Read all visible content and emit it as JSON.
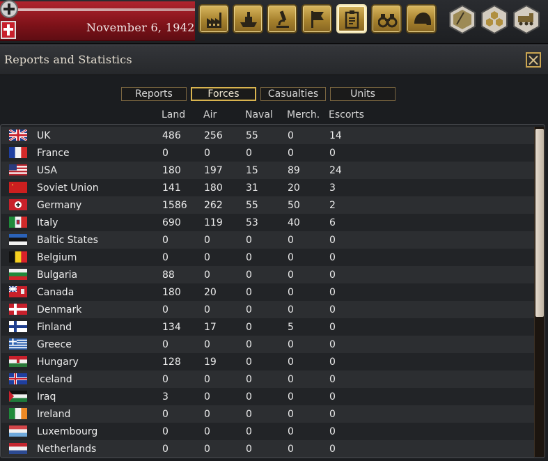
{
  "header": {
    "date": "November 6, 1942"
  },
  "toolbar": {
    "buttons": [
      {
        "icon": "factory-icon"
      },
      {
        "icon": "ship-icon"
      },
      {
        "icon": "microscope-icon"
      },
      {
        "icon": "flag-icon"
      },
      {
        "icon": "clipboard-icon",
        "active": true
      },
      {
        "icon": "binoculars-icon"
      },
      {
        "icon": "helmet-icon"
      }
    ],
    "map_modes": [
      {
        "icon": "terrain-hex-icon"
      },
      {
        "icon": "resource-hex-icon"
      },
      {
        "icon": "supply-train-icon"
      }
    ]
  },
  "panel": {
    "title": "Reports and Statistics",
    "tabs": [
      "Reports",
      "Forces",
      "Casualties",
      "Units"
    ],
    "active_tab": "Forces",
    "columns": [
      "Land",
      "Air",
      "Naval",
      "Merch.",
      "Escorts"
    ]
  },
  "rows": [
    {
      "name": "UK",
      "flag": "uk",
      "land": "486",
      "air": "256",
      "naval": "55",
      "merch": "0",
      "escorts": "14"
    },
    {
      "name": "France",
      "flag": "france",
      "land": "0",
      "air": "0",
      "naval": "0",
      "merch": "0",
      "escorts": "0"
    },
    {
      "name": "USA",
      "flag": "usa",
      "land": "180",
      "air": "197",
      "naval": "15",
      "merch": "89",
      "escorts": "24"
    },
    {
      "name": "Soviet Union",
      "flag": "soviet",
      "land": "141",
      "air": "180",
      "naval": "31",
      "merch": "20",
      "escorts": "3"
    },
    {
      "name": "Germany",
      "flag": "germany",
      "land": "1586",
      "air": "262",
      "naval": "55",
      "merch": "50",
      "escorts": "2"
    },
    {
      "name": "Italy",
      "flag": "italy",
      "land": "690",
      "air": "119",
      "naval": "53",
      "merch": "40",
      "escorts": "6"
    },
    {
      "name": "Baltic States",
      "flag": "baltic",
      "land": "0",
      "air": "0",
      "naval": "0",
      "merch": "0",
      "escorts": "0"
    },
    {
      "name": "Belgium",
      "flag": "belgium",
      "land": "0",
      "air": "0",
      "naval": "0",
      "merch": "0",
      "escorts": "0"
    },
    {
      "name": "Bulgaria",
      "flag": "bulgaria",
      "land": "88",
      "air": "0",
      "naval": "0",
      "merch": "0",
      "escorts": "0"
    },
    {
      "name": "Canada",
      "flag": "canada",
      "land": "180",
      "air": "20",
      "naval": "0",
      "merch": "0",
      "escorts": "0"
    },
    {
      "name": "Denmark",
      "flag": "denmark",
      "land": "0",
      "air": "0",
      "naval": "0",
      "merch": "0",
      "escorts": "0"
    },
    {
      "name": "Finland",
      "flag": "finland",
      "land": "134",
      "air": "17",
      "naval": "0",
      "merch": "5",
      "escorts": "0"
    },
    {
      "name": "Greece",
      "flag": "greece",
      "land": "0",
      "air": "0",
      "naval": "0",
      "merch": "0",
      "escorts": "0"
    },
    {
      "name": "Hungary",
      "flag": "hungary",
      "land": "128",
      "air": "19",
      "naval": "0",
      "merch": "0",
      "escorts": "0"
    },
    {
      "name": "Iceland",
      "flag": "iceland",
      "land": "0",
      "air": "0",
      "naval": "0",
      "merch": "0",
      "escorts": "0"
    },
    {
      "name": "Iraq",
      "flag": "iraq",
      "land": "3",
      "air": "0",
      "naval": "0",
      "merch": "0",
      "escorts": "0"
    },
    {
      "name": "Ireland",
      "flag": "ireland",
      "land": "0",
      "air": "0",
      "naval": "0",
      "merch": "0",
      "escorts": "0"
    },
    {
      "name": "Luxembourg",
      "flag": "luxembourg",
      "land": "0",
      "air": "0",
      "naval": "0",
      "merch": "0",
      "escorts": "0"
    },
    {
      "name": "Netherlands",
      "flag": "netherlands",
      "land": "0",
      "air": "0",
      "naval": "0",
      "merch": "0",
      "escorts": "0"
    }
  ]
}
